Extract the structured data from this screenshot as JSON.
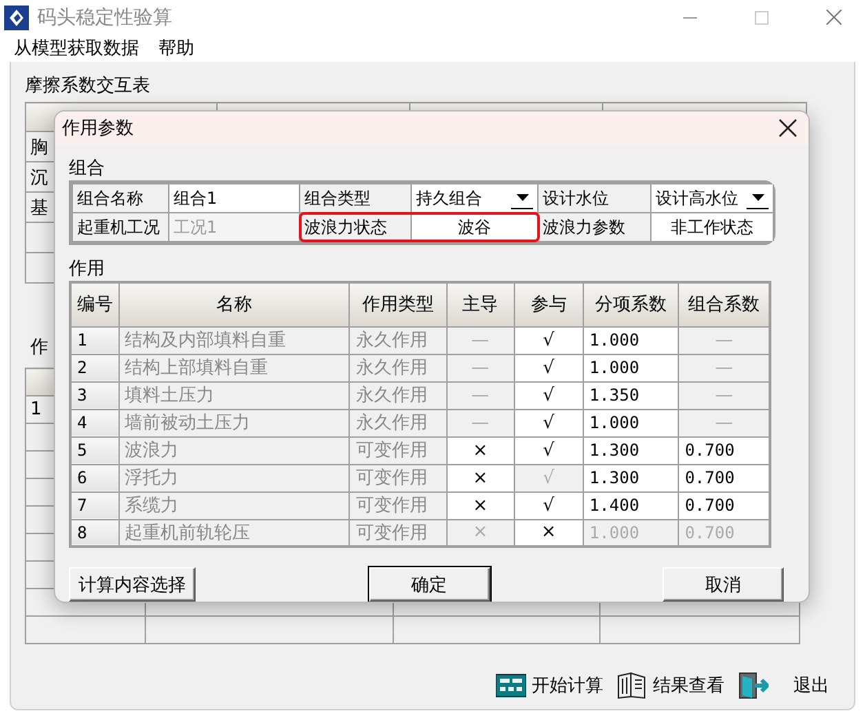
{
  "window": {
    "title": "码头稳定性验算"
  },
  "menu": [
    {
      "label": "从模型获取数据"
    },
    {
      "label": "帮助"
    }
  ],
  "friction_table": {
    "title": "摩擦系数交互表",
    "row_headers": [
      "胸",
      "沉",
      "基"
    ]
  },
  "actions_panel": {
    "title": "作",
    "rows": [
      {
        "id": "1"
      }
    ]
  },
  "toolbar": [
    {
      "kind": "calculate",
      "label": "开始计算"
    },
    {
      "kind": "results",
      "label": "结果查看"
    },
    {
      "kind": "exit",
      "label": "退出"
    }
  ],
  "dialog": {
    "title": "作用参数",
    "combination": {
      "title": "组合",
      "rows": [
        [
          {
            "label": "组合名称",
            "value": "组合1",
            "kind": "text",
            "disabled": false,
            "highlighted": false
          },
          {
            "label": "组合类型",
            "value": "持久组合",
            "kind": "dropdown",
            "disabled": false,
            "highlighted": false
          },
          {
            "label": "设计水位",
            "value": "设计高水位",
            "kind": "dropdown",
            "disabled": false,
            "highlighted": false
          }
        ],
        [
          {
            "label": "起重机工况",
            "value": "工况1",
            "kind": "text",
            "disabled": true,
            "highlighted": false
          },
          {
            "label": "波浪力状态",
            "value": "波谷",
            "kind": "choice",
            "disabled": false,
            "highlighted": true
          },
          {
            "label": "波浪力参数",
            "value": "非工作状态",
            "kind": "choice",
            "disabled": false,
            "highlighted": false
          }
        ]
      ]
    },
    "actions": {
      "title": "作用",
      "columns": [
        "编号",
        "名称",
        "作用类型",
        "主导",
        "参与",
        "分项系数",
        "组合系数"
      ],
      "rows": [
        {
          "id": "1",
          "name": "结构及内部填料自重",
          "type": "永久作用",
          "leading": {
            "text": "—",
            "disabled": true
          },
          "participate": {
            "text": "√",
            "disabled": false
          },
          "factor": {
            "text": "1.000",
            "disabled": false
          },
          "combo": {
            "text": "—",
            "disabled": true
          }
        },
        {
          "id": "2",
          "name": "结构上部填料自重",
          "type": "永久作用",
          "leading": {
            "text": "—",
            "disabled": true
          },
          "participate": {
            "text": "√",
            "disabled": false
          },
          "factor": {
            "text": "1.000",
            "disabled": false
          },
          "combo": {
            "text": "—",
            "disabled": true
          }
        },
        {
          "id": "3",
          "name": "填料土压力",
          "type": "永久作用",
          "leading": {
            "text": "—",
            "disabled": true
          },
          "participate": {
            "text": "√",
            "disabled": false
          },
          "factor": {
            "text": "1.350",
            "disabled": false
          },
          "combo": {
            "text": "—",
            "disabled": true
          }
        },
        {
          "id": "4",
          "name": "墙前被动土压力",
          "type": "永久作用",
          "leading": {
            "text": "—",
            "disabled": true
          },
          "participate": {
            "text": "√",
            "disabled": false
          },
          "factor": {
            "text": "1.000",
            "disabled": false
          },
          "combo": {
            "text": "—",
            "disabled": true
          }
        },
        {
          "id": "5",
          "name": "波浪力",
          "type": "可变作用",
          "leading": {
            "text": "×",
            "disabled": false
          },
          "participate": {
            "text": "√",
            "disabled": false
          },
          "factor": {
            "text": "1.300",
            "disabled": false
          },
          "combo": {
            "text": "0.700",
            "disabled": false
          }
        },
        {
          "id": "6",
          "name": "浮托力",
          "type": "可变作用",
          "leading": {
            "text": "×",
            "disabled": false
          },
          "participate": {
            "text": "√",
            "disabled": true
          },
          "factor": {
            "text": "1.300",
            "disabled": false
          },
          "combo": {
            "text": "0.700",
            "disabled": false
          }
        },
        {
          "id": "7",
          "name": "系缆力",
          "type": "可变作用",
          "leading": {
            "text": "×",
            "disabled": false
          },
          "participate": {
            "text": "√",
            "disabled": false
          },
          "factor": {
            "text": "1.400",
            "disabled": false
          },
          "combo": {
            "text": "0.700",
            "disabled": false
          }
        },
        {
          "id": "8",
          "name": "起重机前轨轮压",
          "type": "可变作用",
          "leading": {
            "text": "×",
            "disabled": true
          },
          "participate": {
            "text": "×",
            "disabled": false
          },
          "factor": {
            "text": "1.000",
            "disabled": true
          },
          "combo": {
            "text": "0.700",
            "disabled": true
          }
        }
      ]
    },
    "buttons": [
      {
        "label": "计算内容选择",
        "default": false
      },
      {
        "label": "确定",
        "default": true
      },
      {
        "label": "取消",
        "default": false
      }
    ]
  }
}
